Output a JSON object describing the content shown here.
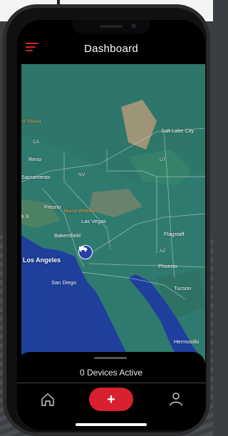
{
  "header": {
    "title": "Dashboard",
    "menu_icon": "hamburger-menu-icon"
  },
  "map": {
    "labels": {
      "mount_shasta": "nt Shasta",
      "ca": "CA",
      "reno": "Reno",
      "sacramento": "Sacramento",
      "nv": "NV",
      "fresno": "Fresno",
      "mount_whitney": "Mount Whitney",
      "k3": "k 3",
      "las_vegas": "Las Vegas",
      "bakersfield": "Bakersfield",
      "los_angeles": "Los Angeles",
      "san_diego": "San Diego",
      "salt_lake_city": "Salt Lake City",
      "ut": "UT",
      "flagstaff": "Flagstaff",
      "az": "AZ",
      "phoenix": "Phoenix",
      "tucson": "Tucson",
      "hermosillo": "Hermosillo"
    },
    "device_icon": "truck-icon"
  },
  "status": {
    "devices_active": "0 Devices Active"
  },
  "nav": {
    "home_icon": "home-icon",
    "add_symbol": "+",
    "profile_icon": "user-icon"
  },
  "colors": {
    "accent": "#d8202f",
    "land": "#2f7a6e",
    "ocean": "#1e3f9c",
    "desert": "#b39a7a",
    "pin": "#2a3ea8"
  }
}
